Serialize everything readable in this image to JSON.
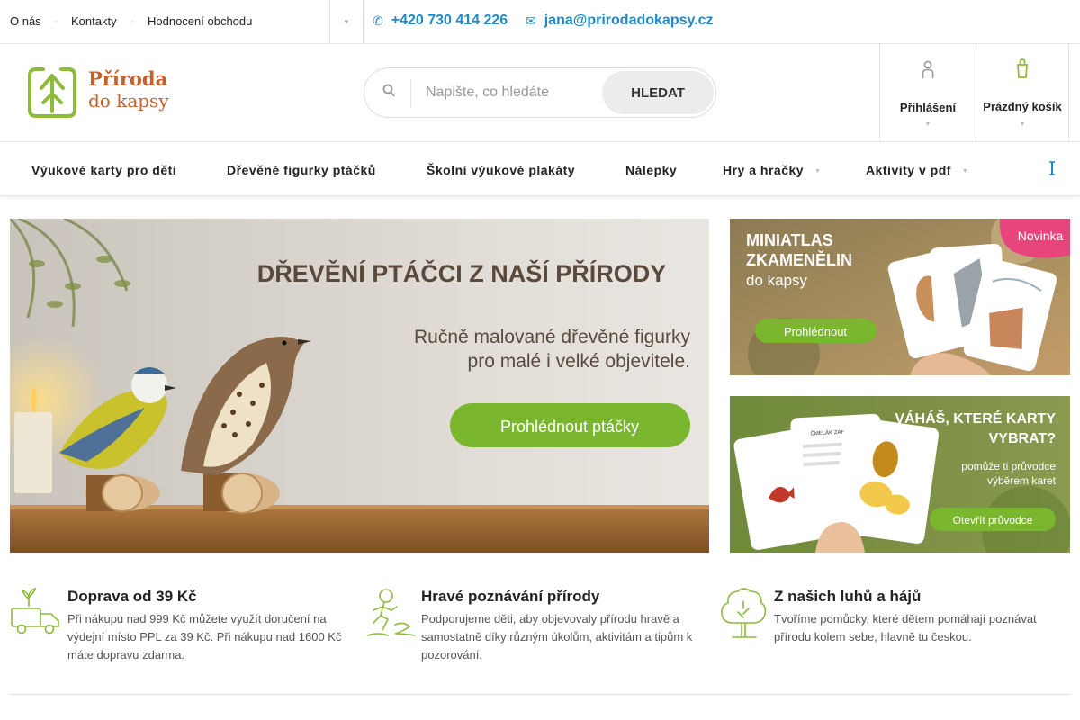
{
  "topbar": {
    "links": [
      "O nás",
      "Kontakty",
      "Hodnocení obchodu"
    ],
    "caret_icon": "caret-down-icon",
    "phone": "+420 730 414 226",
    "email": "jana@prirodadokapsy.cz",
    "accent_color": "#1f8ac9"
  },
  "header": {
    "logo_line1": "Příroda",
    "logo_line2": "do kapsy",
    "logo_color": "#c8602a",
    "search": {
      "placeholder": "Napište, co hledáte",
      "button": "HLEDAT"
    },
    "login_label": "Přihlášení",
    "cart_label": "Prázdný košík"
  },
  "nav": {
    "items": [
      "Výukové karty pro děti",
      "Dřevěné figurky ptáčků",
      "Školní výukové plakáty",
      "Nálepky",
      "Hry a hračky",
      "Aktivity v pdf"
    ]
  },
  "banners": {
    "main": {
      "title": "DŘEVĚNÍ PTÁČCI Z NAŠÍ PŘÍRODY",
      "subtitle_1": "Ručně malované dřevěné figurky",
      "subtitle_2": "pro malé i velké objevitele.",
      "button": "Prohlédnout ptáčky"
    },
    "side1": {
      "title_1": "MINIATLAS",
      "title_2": "ZKAMENĚLIN",
      "title_3": "do kapsy",
      "button": "Prohlédnout",
      "badge": "Novinka"
    },
    "side2": {
      "title_1": "VÁHÁŠ, KTERÉ KARTY",
      "title_2": "VYBRAT?",
      "sub_1": "pomůže ti průvodce",
      "sub_2": "výběrem karet",
      "button": "Otevřít průvodce",
      "card_title": "ČMELÁK ZAHRADNÍ"
    },
    "accent_green": "#7ab72e"
  },
  "features": [
    {
      "title": "Doprava od 39 Kč",
      "text": "Při nákupu nad 999 Kč můžete využít doručení na výdejní místo PPL za 39 Kč. Při nákupu nad 1600 Kč máte dopravu zdarma.",
      "icon": "delivery-truck-icon"
    },
    {
      "title": "Hravé poznávání přírody",
      "text": "Podporujeme děti, aby objevovaly přírodu hravě a samostatně díky různým úkolům, aktivitám a tipům k pozorování.",
      "icon": "running-child-icon"
    },
    {
      "title": "Z našich luhů a hájů",
      "text": "Tvoříme pomůcky, které dětem pomáhají poznávat přírodu kolem sebe, hlavně tu českou.",
      "icon": "tree-icon"
    }
  ]
}
